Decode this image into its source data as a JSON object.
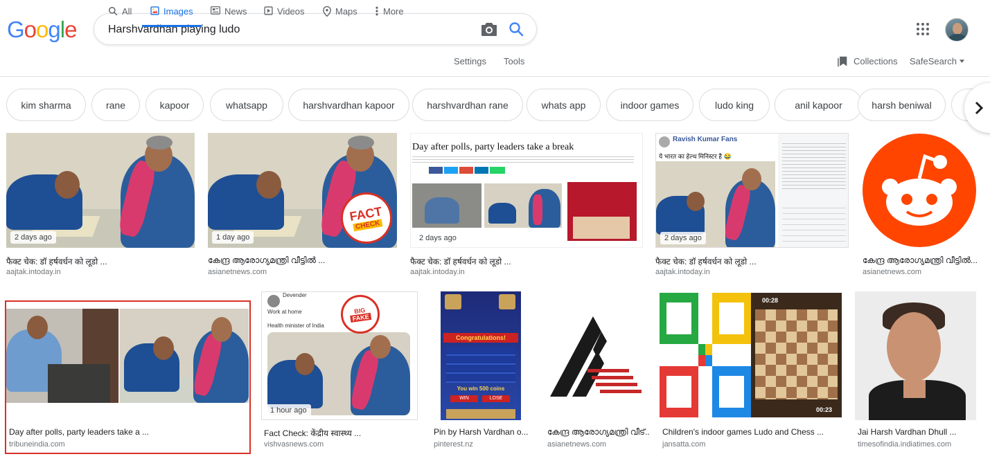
{
  "logo": {
    "letters": [
      "G",
      "o",
      "o",
      "g",
      "l",
      "e"
    ],
    "colors": [
      "#4285F4",
      "#EA4335",
      "#FBBC05",
      "#4285F4",
      "#34A853",
      "#EA4335"
    ]
  },
  "search": {
    "query": "Harshvardhan playing ludo",
    "icons": [
      "camera-icon",
      "search-icon"
    ]
  },
  "nav": {
    "tabs": [
      {
        "label": "All",
        "icon": "search-icon"
      },
      {
        "label": "Images",
        "icon": "image-icon",
        "active": true
      },
      {
        "label": "News",
        "icon": "news-icon"
      },
      {
        "label": "Videos",
        "icon": "video-icon"
      },
      {
        "label": "Maps",
        "icon": "map-pin-icon"
      },
      {
        "label": "More",
        "icon": "more-vert-icon"
      }
    ],
    "settings": "Settings",
    "tools": "Tools",
    "collections": "Collections",
    "safesearch": "SafeSearch"
  },
  "chips": [
    "kim sharma",
    "rane",
    "kapoor",
    "whatsapp",
    "harshvardhan kapoor",
    "harshvardhan rane",
    "whats app",
    "indoor games",
    "ludo king",
    "anil kapoor",
    "harsh beniwal"
  ],
  "results_row1": [
    {
      "caption": "फैक्ट चेक: डॉ हर्षवर्धन को लूडो ...",
      "source": "aajtak.intoday.in",
      "time": "2 days ago"
    },
    {
      "caption": "കേന്ദ്ര ആരോഗ്യമന്ത്രി വീട്ടിൽ ...",
      "source": "asianetnews.com",
      "time": "1 day ago",
      "stamp": [
        "FACT",
        "CHECK"
      ]
    },
    {
      "caption": "फैक्ट चेक: डॉ हर्षवर्धन को लूडो ...",
      "source": "aajtak.intoday.in",
      "time": "2 days ago",
      "headline": "Day after polls, party leaders take a break"
    },
    {
      "caption": "फैक्ट चेक: डॉ हर्षवर्धन को लूडो ...",
      "source": "aajtak.intoday.in",
      "time": "2 days ago",
      "post_author": "Ravish Kumar Fans",
      "post_text": "ये भारत का हेल्थ मिनिस्टर है 😂"
    },
    {
      "caption": "കേന്ദ്ര ആരോഗ്യമന്ത്രി വീട്ടിൽ...",
      "source": "asianetnews.com"
    }
  ],
  "results_row2": [
    {
      "caption": "Day after polls, party leaders take a ...",
      "source": "tribuneindia.com"
    },
    {
      "caption": "Fact Check: केंद्रीय स्वास्थ्य ...",
      "source": "vishvasnews.com",
      "time": "1 hour ago",
      "tweet_lines": [
        "Devender",
        "Work at home",
        "Health minister of India"
      ],
      "stamp": [
        "BIG",
        "FAKE"
      ]
    },
    {
      "caption": "Pin by Harsh Vardhan o...",
      "source": "pinterest.nz",
      "game_banner": "Congratulations!",
      "game_coins": "You win 500 coins",
      "game_buttons": [
        "WIN",
        "LOSE"
      ]
    },
    {
      "caption": "കേന്ദ്ര ആരോഗ്യമന്ത്രി വീട്...",
      "source": "asianetnews.com"
    },
    {
      "caption": "Children's indoor games Ludo and Chess ...",
      "source": "jansatta.com",
      "timer_left": "00:28",
      "timer_right": "00:23"
    },
    {
      "caption": "Jai Harsh Vardhan Dhull ...",
      "source": "timesofindia.indiatimes.com"
    }
  ]
}
